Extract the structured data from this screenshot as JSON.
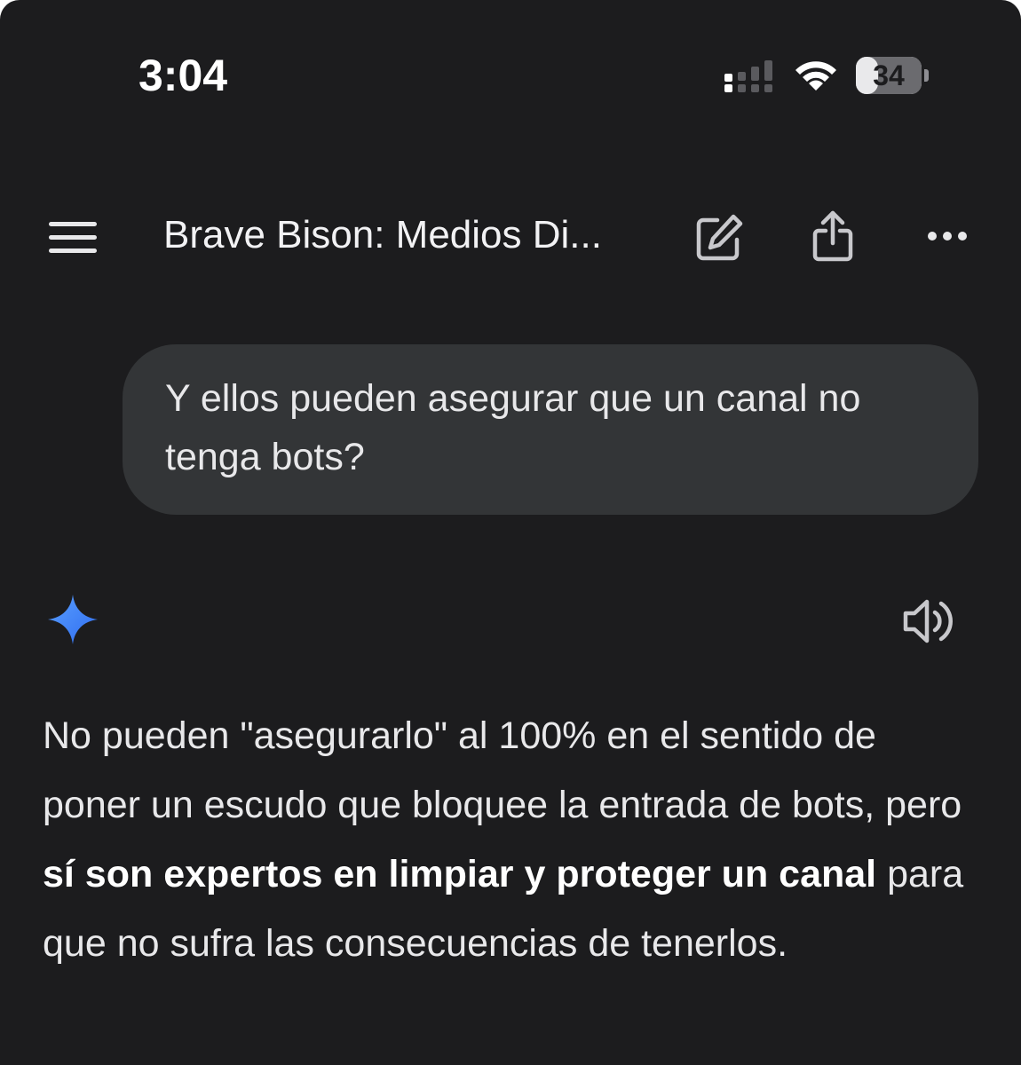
{
  "status_bar": {
    "time": "3:04",
    "battery_level": "34",
    "battery_percent": 34
  },
  "header": {
    "title": "Brave Bison: Medios Di...",
    "icons": [
      "menu-icon",
      "edit-icon",
      "share-icon",
      "more-icon"
    ]
  },
  "conversation": {
    "user_message": "Y ellos pueden asegurar que un canal no tenga bots?",
    "response": {
      "part1": "No pueden \"asegurarlo\" al 100% en el sentido de poner un escudo que bloquee la entrada de bots, pero ",
      "bold": "sí son expertos en limpiar y proteger un canal",
      "part2": " para que no sufra las consecuencias de tenerlos."
    }
  },
  "colors": {
    "background": "#1c1c1e",
    "bubble": "#333537",
    "text": "#e8e8ea",
    "gemini_accent": "#3d7bf5"
  }
}
